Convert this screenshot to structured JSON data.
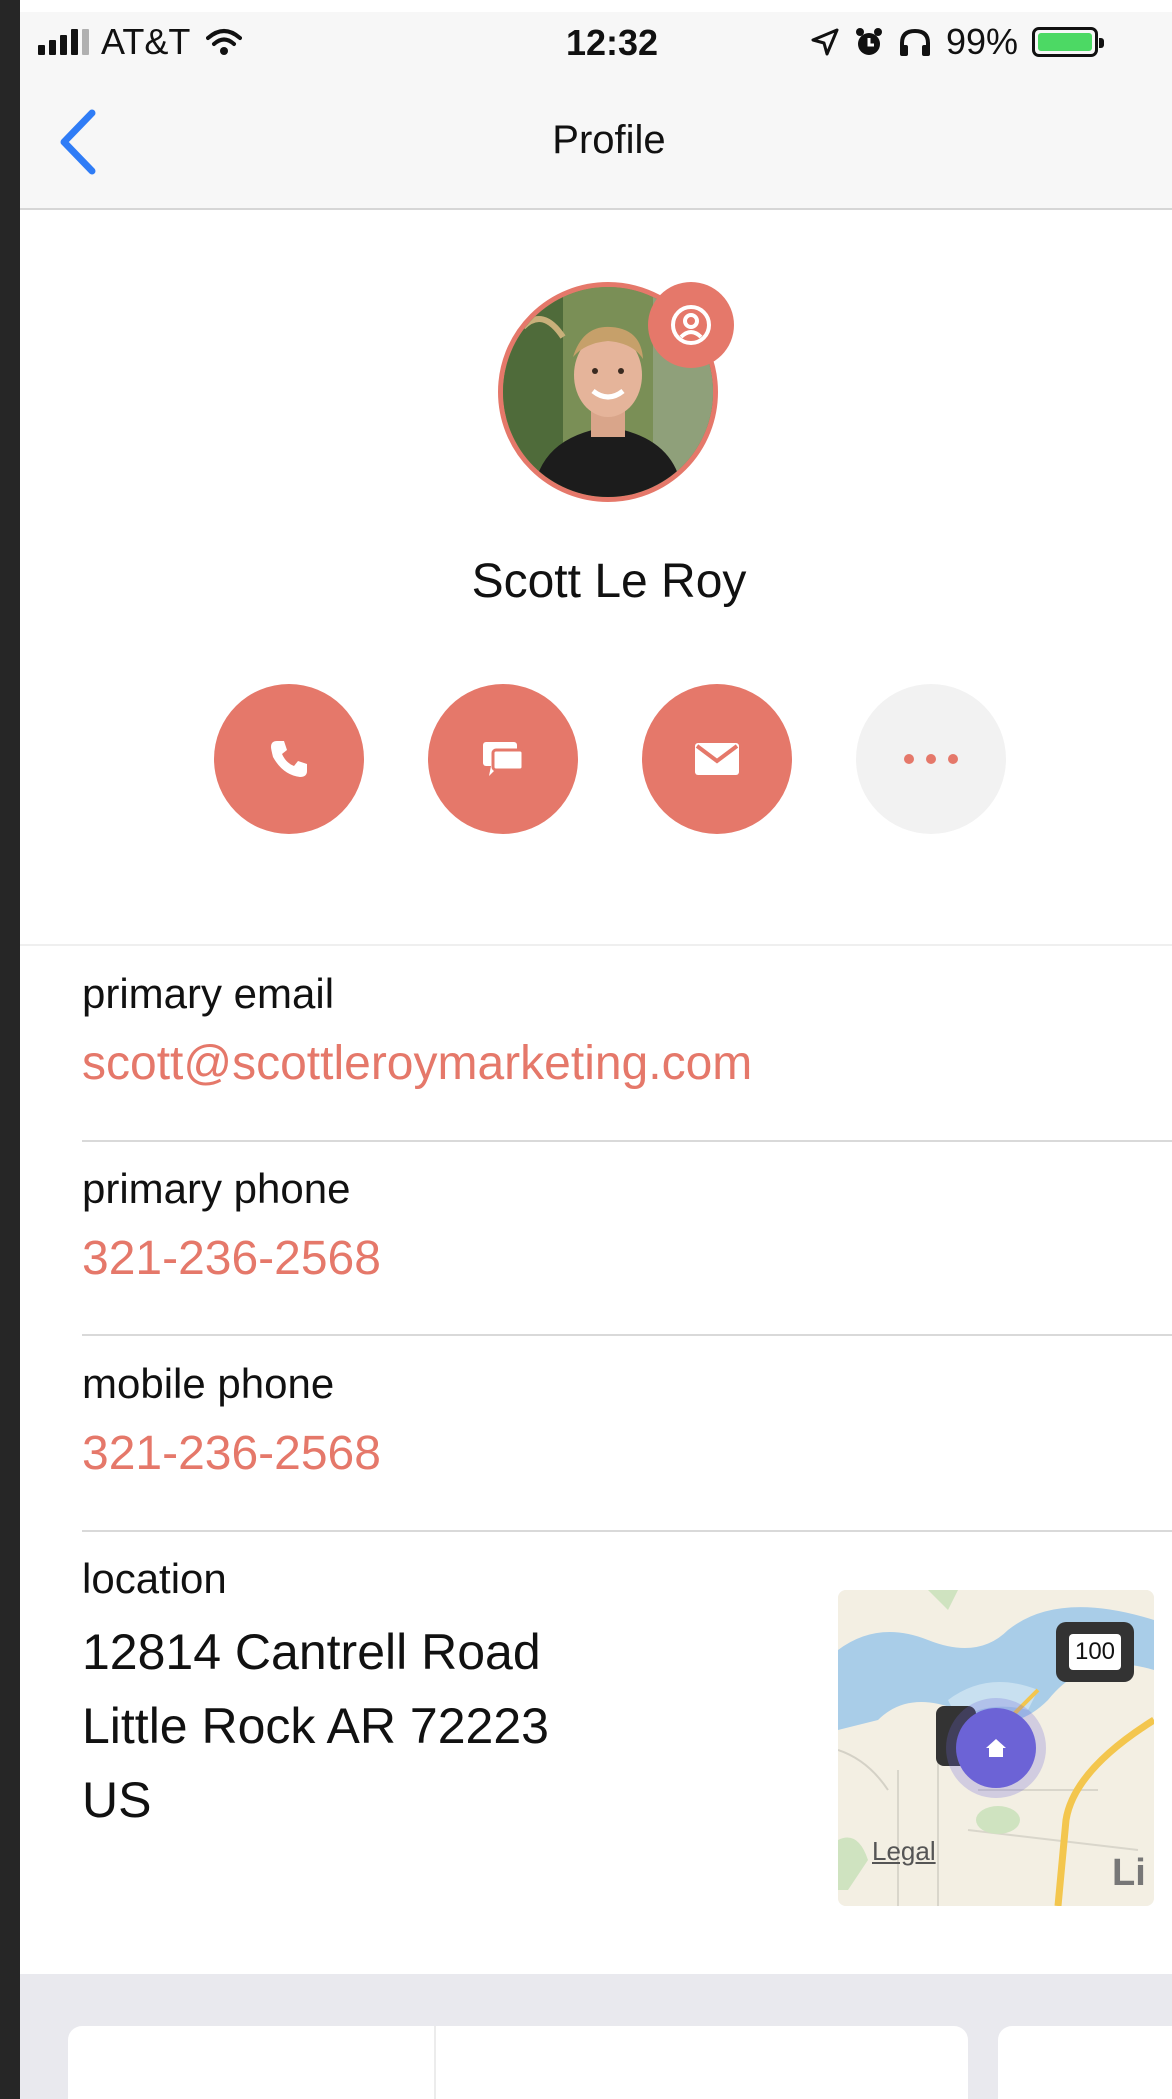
{
  "status_bar": {
    "carrier": "AT&T",
    "time": "12:32",
    "battery": "99%"
  },
  "nav": {
    "title": "Profile"
  },
  "profile": {
    "name": "Scott Le Roy"
  },
  "fields": [
    {
      "label": "primary email",
      "value": "scott@scottleroymarketing.com"
    },
    {
      "label": "primary phone",
      "value": "321-236-2568"
    },
    {
      "label": "mobile phone",
      "value": "321-236-2568"
    }
  ],
  "location": {
    "label": "location",
    "line1": "12814 Cantrell Road",
    "line2": "Little Rock AR 72223",
    "line3": "US",
    "map": {
      "route_shield": "100",
      "legal": "Legal",
      "city_fragment": "Li"
    }
  },
  "colors": {
    "accent": "#e5786a",
    "ios_blue": "#2f7cf6",
    "map_pin": "#6c63d6"
  }
}
